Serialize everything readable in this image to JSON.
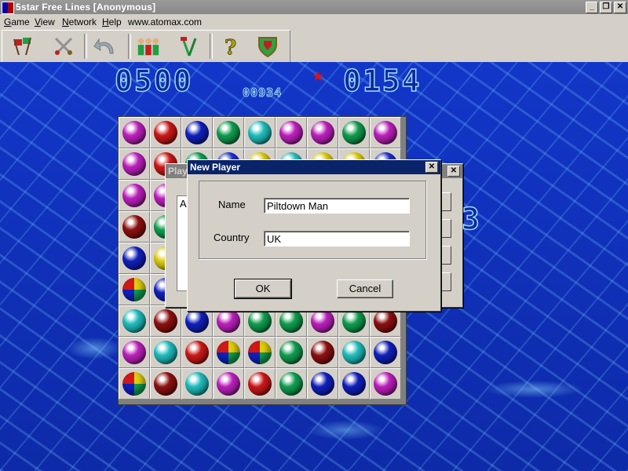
{
  "window": {
    "title": "5star Free Lines [Anonymous]",
    "buttons": [
      "_",
      "❐",
      "✕"
    ]
  },
  "menu": [
    "Game",
    "View",
    "Network",
    "Help"
  ],
  "menu_link": "www.atomax.com",
  "toolbar": [
    "flags-icon",
    "swords-icon",
    "undo-icon",
    "players-icon",
    "tools-icon",
    "help-icon",
    "shield-icon"
  ],
  "scores": {
    "left": "0500",
    "small": "00934",
    "right": "0154"
  },
  "board": {
    "rows": [
      [
        "#c020c0",
        "#d01818",
        "#1020c0",
        "#10a050",
        "#20c0c0",
        "#c020c0",
        "#c020c0",
        "#10a050",
        "#c020c0"
      ],
      [
        "#c020c0",
        "#d01818",
        "#10a050",
        "#2030d0",
        "#e0d010",
        "#30c0c0",
        "#e0d010",
        "#e0d010",
        "#2030d0"
      ],
      [
        "#c020c0",
        "#c020c0",
        "",
        "",
        "",
        "",
        "",
        "",
        ""
      ],
      [
        "#901010",
        "#10a050",
        "",
        "",
        "",
        "",
        "",
        "",
        ""
      ],
      [
        "#1020c0",
        "#e0d010",
        "",
        "",
        "",
        "",
        "",
        "",
        ""
      ],
      [
        "multi",
        "#1020c0",
        "",
        "",
        "",
        "",
        "",
        "",
        ""
      ],
      [
        "#20c0c0",
        "#901010",
        "#1020c0",
        "#c020c0",
        "#10a050",
        "#10a050",
        "#c020c0",
        "#10a050",
        "#901010"
      ],
      [
        "#c020c0",
        "#20c0c0",
        "#d01818",
        "multi",
        "multi",
        "#10a050",
        "#901010",
        "#20c0c0",
        "#1020c0"
      ],
      [
        "multi",
        "#901010",
        "#20c0c0",
        "#c020c0",
        "#d01818",
        "#10a050",
        "#1020c0",
        "#1020c0",
        "#c020c0"
      ]
    ]
  },
  "back_dialog": {
    "title": "Play",
    "partial_text": "A",
    "partial_digit": "3"
  },
  "dialog": {
    "title": "New Player",
    "name_label": "Name",
    "name_value": "Piltdown Man",
    "country_label": "Country",
    "country_value": "UK",
    "ok": "OK",
    "cancel": "Cancel"
  }
}
